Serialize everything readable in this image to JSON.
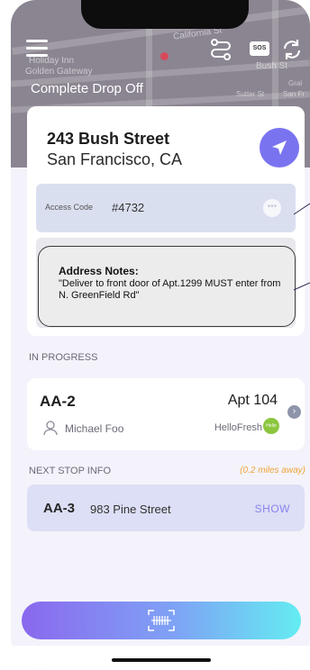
{
  "map": {
    "street_labels": [
      "California St",
      "Holiday Inn",
      "Golden Gateway",
      "Bush St",
      "Sutter St",
      "San Fr",
      "Grai"
    ]
  },
  "header": {
    "title": "Complete Drop Off",
    "sos_label": "SOS"
  },
  "destination": {
    "street": "243 Bush Street",
    "city": "San Francisco, CA",
    "access_code_label": "Access Code",
    "access_code_value": "#4732",
    "notes_title": "Address Notes:",
    "notes_body": "\"Deliver to front door of Apt.1299 MUST enter from N. GreenField Rd\""
  },
  "in_progress": {
    "section_label": "IN PROGRESS",
    "code": "AA-2",
    "apartment": "Apt 104",
    "recipient": "Michael Foo",
    "company": "HelloFresh",
    "company_logo_text": "Hello Fresh"
  },
  "next_stop": {
    "section_label": "NEXT STOP INFO",
    "distance": "(0.2 miles away)",
    "code": "AA-3",
    "street": "983 Pine Street",
    "action": "SHOW"
  },
  "colors": {
    "accent": "#7a73f0",
    "distance": "#f0a33a",
    "gradient_start": "#8a68ee",
    "gradient_end": "#64ecf2"
  },
  "icons": [
    "menu-icon",
    "route-icon",
    "sos-icon",
    "refresh-icon",
    "navigate-arrow-icon",
    "more-dots-icon",
    "person-icon",
    "chevron-right-icon",
    "barcode-scan-icon"
  ]
}
